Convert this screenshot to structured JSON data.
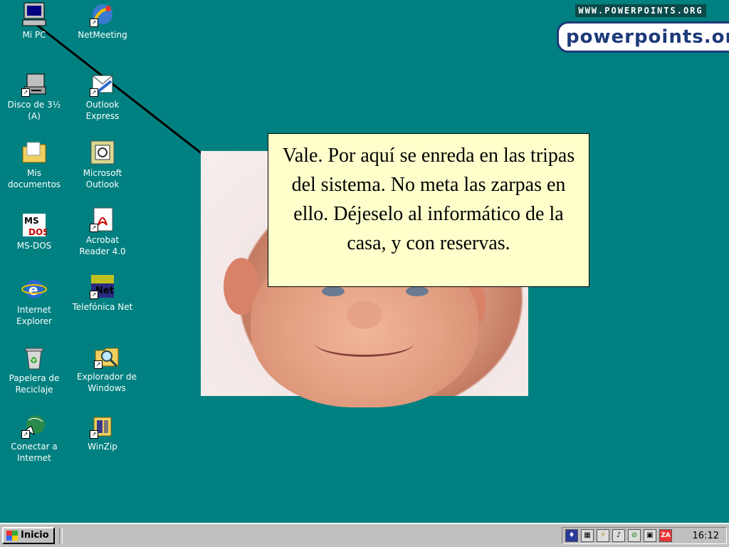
{
  "desktop": {
    "background_color": "#008080",
    "icons": [
      {
        "label": "Mi PC",
        "icon": "my-computer-icon"
      },
      {
        "label": "NetMeeting",
        "icon": "netmeeting-icon"
      },
      {
        "label": "Disco de 3½\n(A)",
        "icon": "floppy-drive-icon"
      },
      {
        "label": "Outlook\nExpress",
        "icon": "outlook-express-icon"
      },
      {
        "label": "Mis\ndocumentos",
        "icon": "my-documents-icon"
      },
      {
        "label": "Microsoft\nOutlook",
        "icon": "microsoft-outlook-icon"
      },
      {
        "label": "MS-DOS",
        "icon": "ms-dos-icon"
      },
      {
        "label": "Acrobat\nReader 4.0",
        "icon": "acrobat-reader-icon"
      },
      {
        "label": "Internet\nExplorer",
        "icon": "internet-explorer-icon"
      },
      {
        "label": "Telefónica Net",
        "icon": "telefonica-net-icon"
      },
      {
        "label": "Papelera de\nReciclaje",
        "icon": "recycle-bin-icon"
      },
      {
        "label": "Explorador de\nWindows",
        "icon": "windows-explorer-icon"
      },
      {
        "label": "Conectar a\nInternet",
        "icon": "connect-internet-icon"
      },
      {
        "label": "WinZip",
        "icon": "winzip-icon"
      }
    ]
  },
  "callout": {
    "text": "Vale. Por aquí se enreda en las tripas del sistema. No meta las zarpas en ello. Déjeselo al informático de la casa, y con reservas.",
    "background": "#ffffcc"
  },
  "brand": {
    "small_url": "WWW.POWERPOINTS.ORG",
    "logo_text": "powerpoints.org"
  },
  "taskbar": {
    "start_label": "Inicio",
    "clock": "16:12",
    "tray_icons": [
      "shield-icon",
      "calendar-icon",
      "power-icon",
      "speaker-icon",
      "network-icon",
      "monitor-icon",
      "za-icon"
    ]
  }
}
